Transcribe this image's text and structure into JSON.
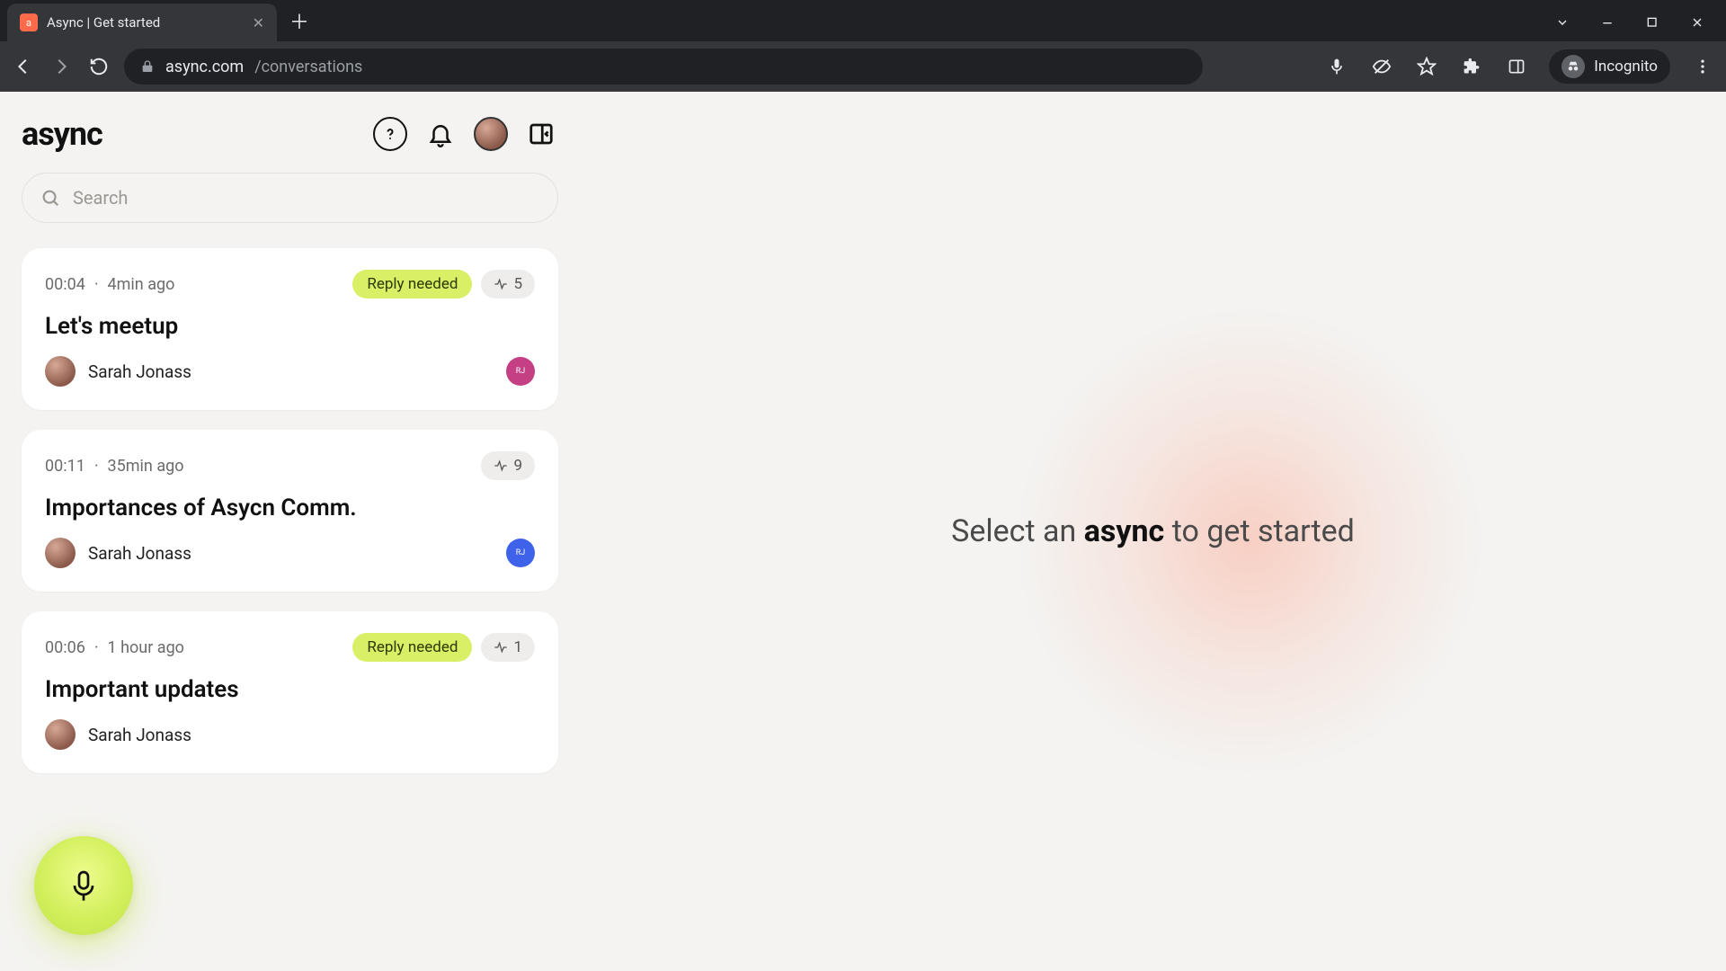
{
  "browser": {
    "tab_title": "Async | Get started",
    "url_host": "async.com",
    "url_path": "/conversations",
    "incognito_label": "Incognito"
  },
  "app": {
    "logo": "async",
    "search_placeholder": "Search",
    "empty_prefix": "Select an ",
    "empty_bold": "async",
    "empty_suffix": " to get started"
  },
  "items": [
    {
      "duration": "00:04",
      "age": "4min ago",
      "reply_needed": "Reply needed",
      "count": "5",
      "title": "Let's meetup",
      "author": "Sarah Jonass",
      "dot_color": "magenta",
      "dot_text": "RJ"
    },
    {
      "duration": "00:11",
      "age": "35min ago",
      "reply_needed": "",
      "count": "9",
      "title": "Importances of Asycn Comm.",
      "author": "Sarah Jonass",
      "dot_color": "blue",
      "dot_text": "RJ"
    },
    {
      "duration": "00:06",
      "age": "1 hour ago",
      "reply_needed": "Reply needed",
      "count": "1",
      "title": "Important updates",
      "author": "Sarah Jonass",
      "dot_color": "",
      "dot_text": ""
    }
  ]
}
